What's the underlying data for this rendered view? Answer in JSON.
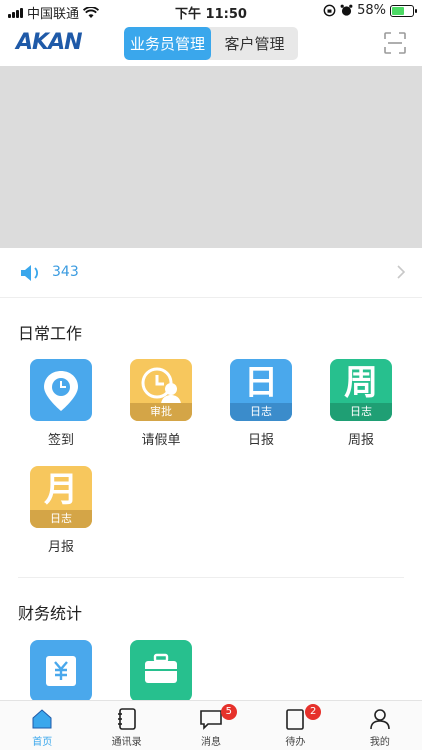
{
  "status_bar": {
    "carrier": "中国联通",
    "time": "下午 11:50",
    "battery": "58%",
    "battery_level": 0.58
  },
  "header": {
    "logo_text": "AKAN",
    "segments": [
      {
        "label": "业务员管理",
        "active": true
      },
      {
        "label": "客户管理",
        "active": false
      }
    ]
  },
  "notice": {
    "count": "343"
  },
  "daily_work": {
    "title": "日常工作",
    "items": [
      {
        "label": "签到",
        "icon": "location-pin-clock-icon",
        "color": "#4aa8ec"
      },
      {
        "label": "请假单",
        "icon": "clock-person-icon",
        "color": "#f7c75d",
        "band": "审批",
        "band_color": "#d4a547"
      },
      {
        "label": "日报",
        "icon": "calendar-day-icon",
        "color": "#4aa8ec",
        "char": "日",
        "band": "日志",
        "band_color": "#3b8ccb"
      },
      {
        "label": "周报",
        "icon": "calendar-week-icon",
        "color": "#27c08e",
        "char": "周",
        "band": "日志",
        "band_color": "#1f9f74"
      },
      {
        "label": "月报",
        "icon": "calendar-month-icon",
        "color": "#f7c75d",
        "char": "月",
        "band": "日志",
        "band_color": "#d4a547"
      }
    ]
  },
  "finance": {
    "title": "财务统计",
    "items": [
      {
        "icon": "yuan-box-icon",
        "color": "#4aa8ec"
      },
      {
        "icon": "briefcase-icon",
        "color": "#27c08e"
      }
    ]
  },
  "tabbar": {
    "tabs": [
      {
        "label": "首页",
        "icon": "home-icon",
        "active": true,
        "badge": ""
      },
      {
        "label": "通讯录",
        "icon": "contacts-icon",
        "active": false,
        "badge": ""
      },
      {
        "label": "消息",
        "icon": "message-icon",
        "active": false,
        "badge": "5"
      },
      {
        "label": "待办",
        "icon": "todo-icon",
        "active": false,
        "badge": "2"
      },
      {
        "label": "我的",
        "icon": "person-icon",
        "active": false,
        "badge": ""
      }
    ]
  }
}
